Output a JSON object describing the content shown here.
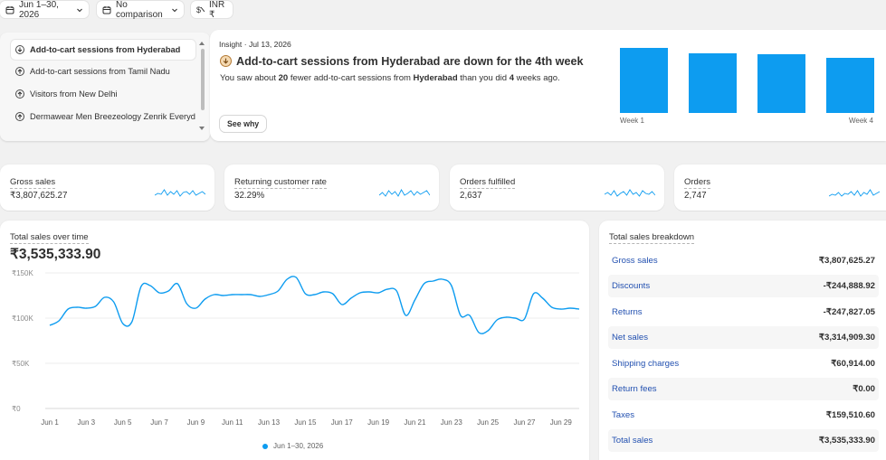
{
  "filters": {
    "date_range": "Jun 1–30, 2026",
    "comparison": "No comparison",
    "currency": "INR ₹"
  },
  "insights": {
    "items": [
      {
        "label": "Add-to-cart sessions from Hyderabad",
        "active": true
      },
      {
        "label": "Add-to-cart sessions from Tamil Nadu",
        "active": false
      },
      {
        "label": "Visitors from New Delhi",
        "active": false
      },
      {
        "label": "Dermawear Men Breezeology Zenrik Everyd...",
        "active": false
      }
    ],
    "detail": {
      "meta": "Insight · Jul 13, 2026",
      "title": "Add-to-cart sessions from Hyderabad are down for the 4th week",
      "desc_prefix": "You saw about ",
      "desc_count": "20",
      "desc_mid": " fewer add-to-cart sessions from ",
      "desc_city": "Hyderabad",
      "desc_mid2": " than you did ",
      "desc_weeks": "4",
      "desc_suffix": " weeks ago.",
      "button": "See why",
      "week_start_label": "Week 1",
      "week_end_label": "Week 4",
      "week_levels": [
        1.0,
        0.92,
        0.9,
        0.85
      ]
    }
  },
  "metrics": [
    {
      "title": "Gross sales",
      "value": "₹3,807,625.27"
    },
    {
      "title": "Returning customer rate",
      "value": "32.29%"
    },
    {
      "title": "Orders fulfilled",
      "value": "2,637"
    },
    {
      "title": "Orders",
      "value": "2,747"
    }
  ],
  "total_sales": {
    "title": "Total sales over time",
    "total": "₹3,535,333.90",
    "legend": "Jun 1–30, 2026"
  },
  "chart_data": {
    "type": "line",
    "title": "Total sales over time",
    "y_ticks": [
      "₹150K",
      "₹100K",
      "₹50K",
      "₹0"
    ],
    "ylim": [
      0,
      150000
    ],
    "x_tick_labels": [
      "Jun 1",
      "Jun 3",
      "Jun 5",
      "Jun 7",
      "Jun 9",
      "Jun 11",
      "Jun 13",
      "Jun 15",
      "Jun 17",
      "Jun 19",
      "Jun 21",
      "Jun 23",
      "Jun 25",
      "Jun 27",
      "Jun 29"
    ],
    "x_day_start": 1,
    "x_day_end": 30,
    "series": [
      {
        "name": "Jun 1–30, 2026",
        "color": "#0d9cf0",
        "points": [
          [
            1,
            92000
          ],
          [
            1.5,
            97000
          ],
          [
            2,
            110000
          ],
          [
            2.5,
            112000
          ],
          [
            3,
            111000
          ],
          [
            3.5,
            113000
          ],
          [
            4,
            123000
          ],
          [
            4.5,
            118000
          ],
          [
            5,
            94000
          ],
          [
            5.5,
            96000
          ],
          [
            6,
            135000
          ],
          [
            6.5,
            136000
          ],
          [
            7,
            128000
          ],
          [
            7.5,
            130000
          ],
          [
            8,
            138000
          ],
          [
            8.5,
            116000
          ],
          [
            9,
            111000
          ],
          [
            9.5,
            121000
          ],
          [
            10,
            126000
          ],
          [
            10.5,
            125000
          ],
          [
            11,
            126000
          ],
          [
            11.5,
            126000
          ],
          [
            12,
            126000
          ],
          [
            12.5,
            124000
          ],
          [
            13,
            126000
          ],
          [
            13.5,
            130000
          ],
          [
            14,
            143000
          ],
          [
            14.5,
            145000
          ],
          [
            15,
            127000
          ],
          [
            15.5,
            126000
          ],
          [
            16,
            129000
          ],
          [
            16.5,
            127000
          ],
          [
            17,
            115000
          ],
          [
            17.5,
            122000
          ],
          [
            18,
            128000
          ],
          [
            18.5,
            129000
          ],
          [
            19,
            128000
          ],
          [
            19.5,
            132000
          ],
          [
            20,
            130000
          ],
          [
            20.5,
            103000
          ],
          [
            21,
            120000
          ],
          [
            21.5,
            138000
          ],
          [
            22,
            141000
          ],
          [
            22.5,
            143000
          ],
          [
            23,
            136000
          ],
          [
            23.5,
            103000
          ],
          [
            24,
            103000
          ],
          [
            24.5,
            84000
          ],
          [
            25,
            86000
          ],
          [
            25.5,
            98000
          ],
          [
            26,
            101000
          ],
          [
            26.5,
            100000
          ],
          [
            27,
            99000
          ],
          [
            27.5,
            127000
          ],
          [
            28,
            122000
          ],
          [
            28.5,
            112000
          ],
          [
            29,
            110000
          ],
          [
            29.5,
            111000
          ],
          [
            30,
            110000
          ]
        ]
      }
    ]
  },
  "breakdown": {
    "title": "Total sales breakdown",
    "rows": [
      {
        "label": "Gross sales",
        "value": "₹3,807,625.27"
      },
      {
        "label": "Discounts",
        "value": "-₹244,888.92"
      },
      {
        "label": "Returns",
        "value": "-₹247,827.05"
      },
      {
        "label": "Net sales",
        "value": "₹3,314,909.30"
      },
      {
        "label": "Shipping charges",
        "value": "₹60,914.00"
      },
      {
        "label": "Return fees",
        "value": "₹0.00"
      },
      {
        "label": "Taxes",
        "value": "₹159,510.60"
      },
      {
        "label": "Total sales",
        "value": "₹3,535,333.90"
      }
    ]
  },
  "colors": {
    "accent": "#0d9cf0",
    "link": "#2250b0"
  }
}
